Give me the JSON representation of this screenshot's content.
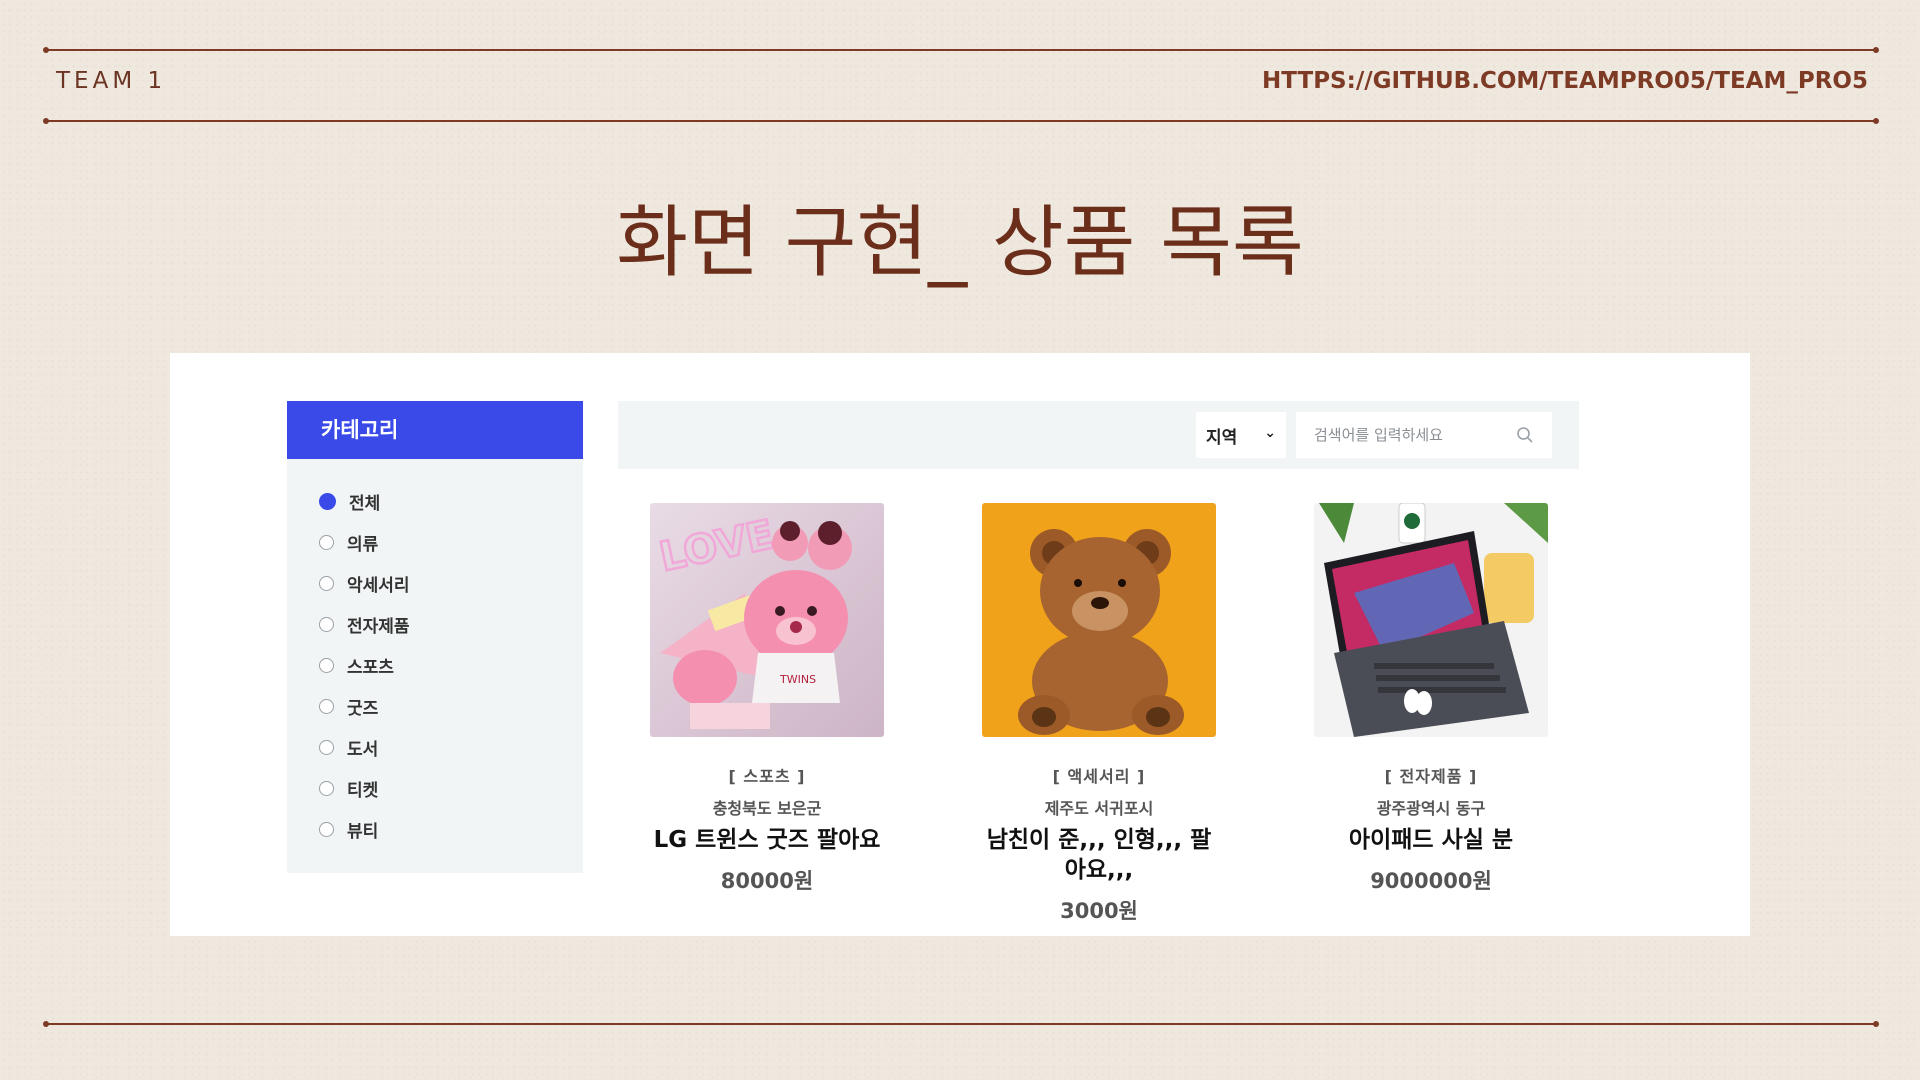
{
  "header": {
    "team": "TEAM 1",
    "url": "HTTPS://GITHUB.COM/TEAMPRO05/TEAM_PRO5"
  },
  "slide_title": "화면 구현_ 상품 목록",
  "sidebar": {
    "title": "카테고리",
    "items": [
      {
        "label": "전체",
        "selected": true
      },
      {
        "label": "의류",
        "selected": false
      },
      {
        "label": "악세서리",
        "selected": false
      },
      {
        "label": "전자제품",
        "selected": false
      },
      {
        "label": "스포츠",
        "selected": false
      },
      {
        "label": "굿즈",
        "selected": false
      },
      {
        "label": "도서",
        "selected": false
      },
      {
        "label": "티켓",
        "selected": false
      },
      {
        "label": "뷰티",
        "selected": false
      }
    ]
  },
  "toolbar": {
    "region_label": "지역",
    "search_placeholder": "검색어를 입력하세요"
  },
  "products": [
    {
      "category": "[ 스포츠 ]",
      "location": "충청북도 보은군",
      "name": "LG 트윈스 굿즈 팔아요",
      "price": "80000원",
      "image": "pink-plush-mascot"
    },
    {
      "category": "[ 액세서리 ]",
      "location": "제주도 서귀포시",
      "name": "남친이 준,,, 인형,,, 팔아요,,,",
      "price": "3000원",
      "image": "teddy-bear"
    },
    {
      "category": "[ 전자제품 ]",
      "location": "광주광역시 동구",
      "name": "아이패드 사실 분",
      "price": "9000000원",
      "image": "ipad-with-keyboard"
    }
  ],
  "colors": {
    "accent": "#3a4ae8",
    "rule": "#7d3a25",
    "title": "#6b2e1b",
    "panel": "#f1f5f6"
  }
}
